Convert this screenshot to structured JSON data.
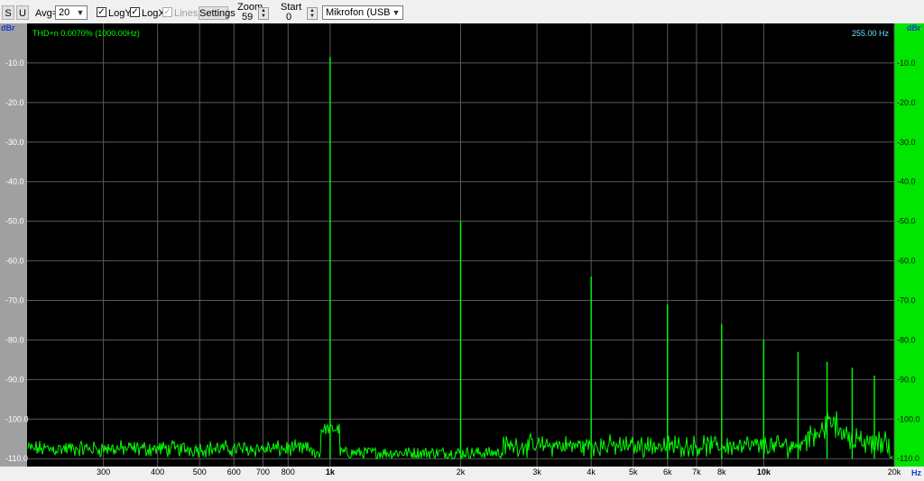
{
  "toolbar": {
    "s_button": "S",
    "u_button": "U",
    "avg_label": "Avg=",
    "avg_value": "20",
    "logy_label": "LogY",
    "logy_checked": true,
    "logx_label": "LogX",
    "logx_checked": true,
    "lines_label": "Lines",
    "lines_checked": true,
    "settings_button": "Settings",
    "zoom_label": "Zoom",
    "zoom_value": "59",
    "start_label": "Start",
    "start_value": "0",
    "device_value": "Mikrofon (USB Audio"
  },
  "plot": {
    "thd_readout": "THD+n 0.0070% (1000.00Hz)",
    "cursor_readout": "255.00 Hz",
    "y_unit_left": "dBr",
    "y_unit_right": "dBr",
    "x_unit": "Hz",
    "colors": {
      "background": "#000000",
      "trace": "#00ff00",
      "grid": "#5a5a5a",
      "left_axis": "#a0a0a0",
      "right_axis": "#00e600",
      "cursor_text": "#66e0ff"
    }
  },
  "chart_data": {
    "type": "line",
    "x_scale": "log",
    "xlim": [
      200,
      20000
    ],
    "ylim": [
      -112,
      0
    ],
    "y_ticks": [
      "-10.0",
      "-20.0",
      "-30.0",
      "-40.0",
      "-50.0",
      "-60.0",
      "-70.0",
      "-80.0",
      "-90.0",
      "-100.0",
      "-110.0"
    ],
    "y_tick_values": [
      -10,
      -20,
      -30,
      -40,
      -50,
      -60,
      -70,
      -80,
      -90,
      -100,
      -110
    ],
    "x_ticks": [
      {
        "label": "300",
        "value": 300
      },
      {
        "label": "400",
        "value": 400
      },
      {
        "label": "500",
        "value": 500
      },
      {
        "label": "600",
        "value": 600
      },
      {
        "label": "700",
        "value": 700
      },
      {
        "label": "800",
        "value": 800
      },
      {
        "label": "1k",
        "value": 1000
      },
      {
        "label": "2k",
        "value": 2000
      },
      {
        "label": "3k",
        "value": 3000
      },
      {
        "label": "4k",
        "value": 4000
      },
      {
        "label": "5k",
        "value": 5000
      },
      {
        "label": "6k",
        "value": 6000
      },
      {
        "label": "7k",
        "value": 7000
      },
      {
        "label": "8k",
        "value": 8000
      },
      {
        "label": "10k",
        "value": 10000
      },
      {
        "label": "20k",
        "value": 20000
      }
    ],
    "peaks": [
      {
        "freq": 1000,
        "db": -8.5
      },
      {
        "freq": 2000,
        "db": -50
      },
      {
        "freq": 4000,
        "db": -64
      },
      {
        "freq": 6000,
        "db": -71
      },
      {
        "freq": 8000,
        "db": -76
      },
      {
        "freq": 10000,
        "db": -80
      },
      {
        "freq": 12000,
        "db": -83
      },
      {
        "freq": 14000,
        "db": -85.5
      },
      {
        "freq": 16000,
        "db": -87
      },
      {
        "freq": 18000,
        "db": -89
      }
    ],
    "noise_floor_db": -110
  }
}
